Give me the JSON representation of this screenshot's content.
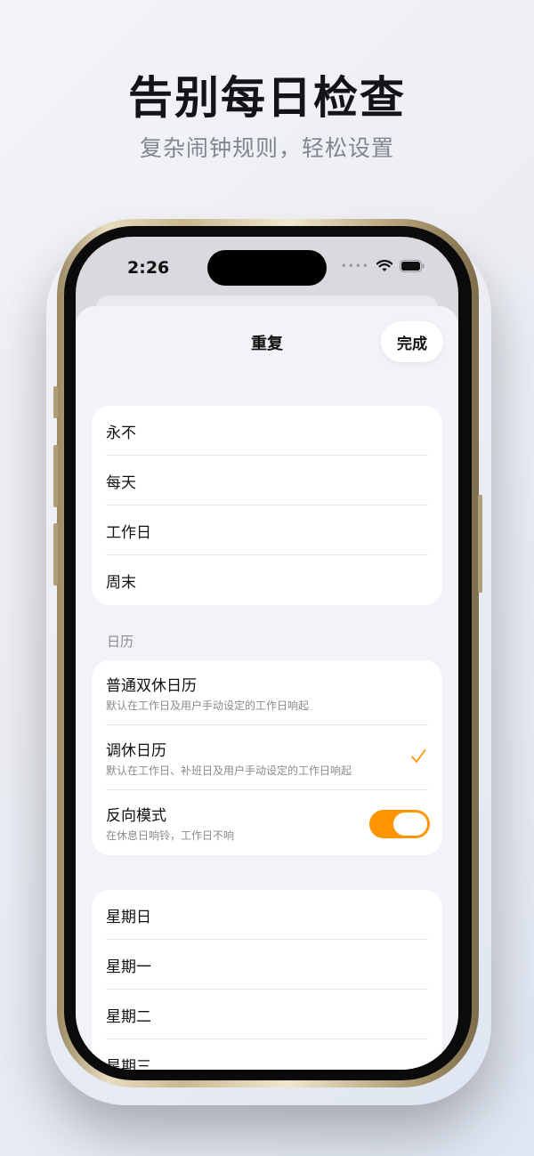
{
  "promo": {
    "headline": "告别每日检查",
    "subline": "复杂闹钟规则，轻松设置"
  },
  "status_bar": {
    "time": "2:26",
    "icons": [
      "signal-dots-icon",
      "wifi-icon",
      "battery-icon"
    ]
  },
  "sheet": {
    "title": "重复",
    "done_label": "完成"
  },
  "repeat_options": [
    {
      "label": "永不"
    },
    {
      "label": "每天"
    },
    {
      "label": "工作日"
    },
    {
      "label": "周末"
    }
  ],
  "calendar": {
    "header": "日历",
    "items": [
      {
        "label": "普通双休日历",
        "desc": "默认在工作日及用户手动设定的工作日响起",
        "selected": false
      },
      {
        "label": "调休日历",
        "desc": "默认在工作日、补班日及用户手动设定的工作日响起",
        "selected": true
      },
      {
        "label": "反向模式",
        "desc": "在休息日响铃，工作日不响",
        "toggle_on": true
      }
    ]
  },
  "weekdays": [
    {
      "label": "星期日"
    },
    {
      "label": "星期一"
    },
    {
      "label": "星期二"
    },
    {
      "label": "星期三"
    }
  ],
  "colors": {
    "accent": "#ff9500",
    "background": "#f2f2f7",
    "card": "#ffffff"
  }
}
